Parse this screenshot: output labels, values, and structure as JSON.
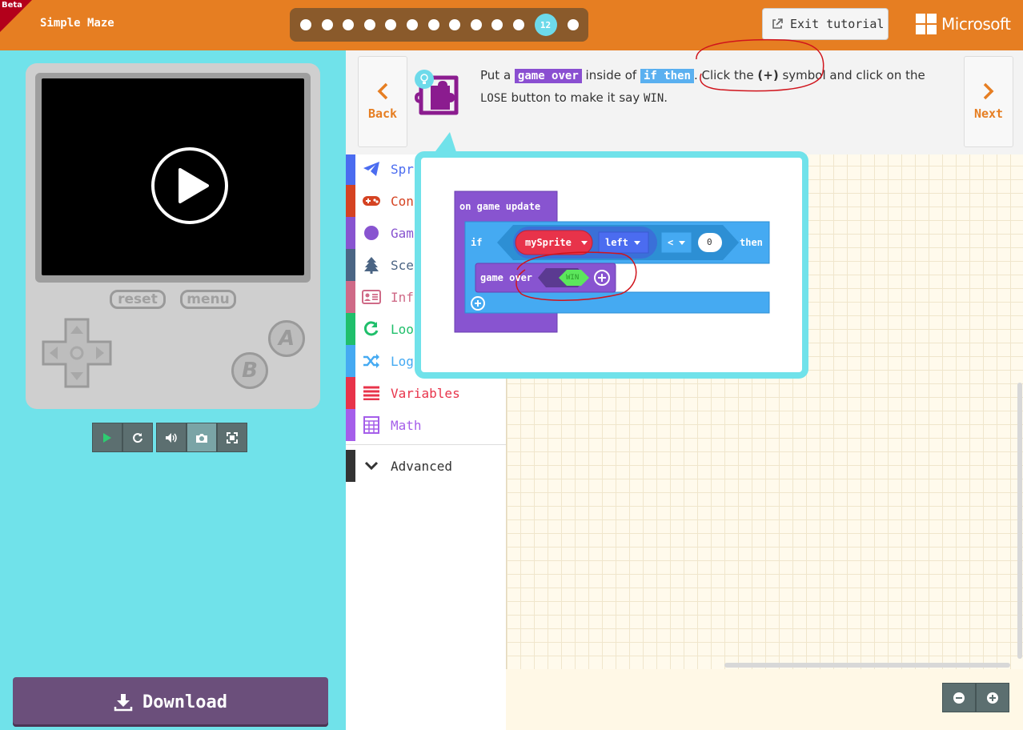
{
  "header": {
    "beta": "Beta",
    "title": "Simple Maze",
    "current_step": "12",
    "exit_label": "Exit tutorial",
    "brand": "Microsoft"
  },
  "simulator": {
    "reset_label": "reset",
    "menu_label": "menu",
    "a_label": "A",
    "b_label": "B",
    "download_label": "Download"
  },
  "tutorial": {
    "back_label": "Back",
    "next_label": "Next",
    "instruction": {
      "p1": "Put a ",
      "kw1": "game over",
      "p2": " inside of ",
      "kw2": "if then",
      "p3": ". Click the ",
      "bold": "(+)",
      "p4": " symbol and click on the ",
      "mono1": "LOSE",
      "p5": " button to make it say ",
      "mono2": "WIN",
      "p6": "."
    }
  },
  "toolbox": {
    "categories": [
      {
        "label": "Spr",
        "color": "#4b6cf0"
      },
      {
        "label": "Con",
        "color": "#d54322"
      },
      {
        "label": "Gam",
        "color": "#8854d0"
      },
      {
        "label": "Sce",
        "color": "#4b6584"
      },
      {
        "label": "Inf",
        "color": "#cf6a87"
      },
      {
        "label": "Loo",
        "color": "#20bf6b"
      },
      {
        "label": "Log",
        "color": "#45aaf2"
      },
      {
        "label": "Variables",
        "color": "#e8334a"
      },
      {
        "label": "Math",
        "color": "#a55eea"
      }
    ],
    "advanced_label": "Advanced"
  },
  "hint_blocks": {
    "event_label": "on game update",
    "if_label": "if",
    "sprite_var": "mySprite",
    "property": "left",
    "operator": "<",
    "value": "0",
    "then_label": "then",
    "action_label": "game over",
    "win_value": "WIN"
  },
  "colors": {
    "header": "#e67e22",
    "sim_bg": "#70e2ea",
    "download": "#6b4f7b",
    "game_purple": "#8854d0",
    "logic_blue": "#45aaf2",
    "sprite_red": "#e8334a",
    "win_green": "#5ce65c"
  }
}
